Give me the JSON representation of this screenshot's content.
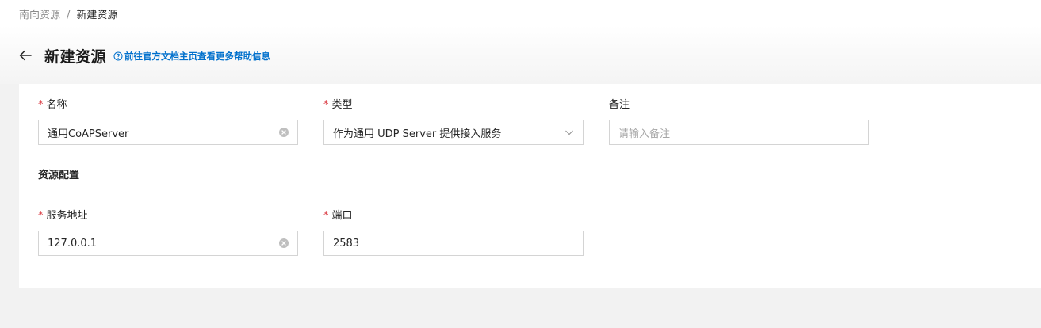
{
  "breadcrumb": {
    "parent": "南向资源",
    "separator": "/",
    "current": "新建资源"
  },
  "header": {
    "title": "新建资源",
    "help_link": "前往官方文档主页查看更多帮助信息"
  },
  "form": {
    "name": {
      "label": "名称",
      "required": "*",
      "value": "通用CoAPServer"
    },
    "type": {
      "label": "类型",
      "required": "*",
      "value": "作为通用 UDP Server 提供接入服务"
    },
    "remark": {
      "label": "备注",
      "placeholder": "请输入备注"
    },
    "section_title": "资源配置",
    "address": {
      "label": "服务地址",
      "required": "*",
      "value": "127.0.0.1"
    },
    "port": {
      "label": "端口",
      "required": "*",
      "value": "2583"
    }
  },
  "icons": {
    "back": "arrow-left-icon",
    "help": "question-circle-icon",
    "clear": "close-circle-icon",
    "dropdown": "chevron-down-icon"
  },
  "colors": {
    "link": "#0070cc",
    "required": "#d9363e",
    "background": "#f2f2f2"
  }
}
